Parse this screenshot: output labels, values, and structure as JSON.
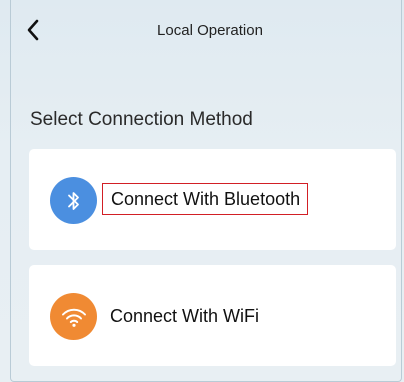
{
  "header": {
    "back_icon": "chevron-left-icon",
    "title": "Local Operation"
  },
  "section_title": "Select Connection Method",
  "options": [
    {
      "label": "Connect With Bluetooth",
      "icon": "bluetooth-icon",
      "icon_color": "#4b8fe0",
      "highlighted": true
    },
    {
      "label": "Connect With WiFi",
      "icon": "wifi-icon",
      "icon_color": "#f08a33",
      "highlighted": false
    }
  ],
  "colors": {
    "highlight_border": "#d21f25"
  }
}
